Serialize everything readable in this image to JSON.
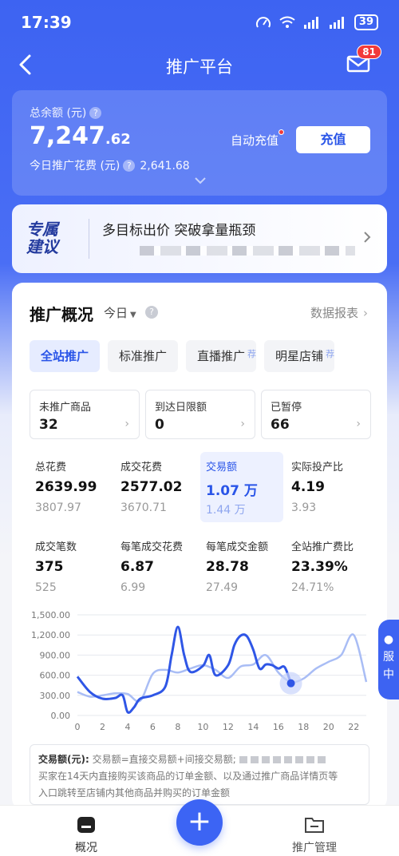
{
  "status_bar": {
    "time": "17:39",
    "battery": "39"
  },
  "nav": {
    "title": "推广平台",
    "mail_badge": "81"
  },
  "balance": {
    "label": "总余额 (元)",
    "amount_int": "7,247",
    "amount_dec": ".62",
    "today_label": "今日推广花费 (元)",
    "today_value": "2,641.68",
    "auto_recharge": "自动充值",
    "recharge_button": "充值"
  },
  "banner": {
    "logo_line1": "专属",
    "logo_line2": "建议",
    "text": "多目标出价 突破拿量瓶颈"
  },
  "overview": {
    "title": "推广概况",
    "date": "今日",
    "report_link": "数据报表",
    "tabs": [
      {
        "label": "全站推广",
        "rec": ""
      },
      {
        "label": "标准推广",
        "rec": ""
      },
      {
        "label": "直播推广",
        "rec": "荐"
      },
      {
        "label": "明星店铺",
        "rec": "荐"
      }
    ],
    "stat_boxes": [
      {
        "label": "未推广商品",
        "value": "32"
      },
      {
        "label": "到达日限额",
        "value": "0"
      },
      {
        "label": "已暂停",
        "value": "66"
      }
    ],
    "metrics": [
      {
        "label": "总花费",
        "value": "2639.99",
        "sub": "3807.97"
      },
      {
        "label": "成交花费",
        "value": "2577.02",
        "sub": "3670.71"
      },
      {
        "label": "交易额",
        "value": "1.07 万",
        "sub": "1.44 万"
      },
      {
        "label": "实际投产比",
        "value": "4.19",
        "sub": "3.93"
      },
      {
        "label": "成交笔数",
        "value": "375",
        "sub": "525"
      },
      {
        "label": "每笔成交花费",
        "value": "6.87",
        "sub": "6.99"
      },
      {
        "label": "每笔成交金额",
        "value": "28.78",
        "sub": "27.49"
      },
      {
        "label": "全站推广费比",
        "value": "23.39%",
        "sub": "24.71%"
      }
    ]
  },
  "chart_data": {
    "type": "line",
    "y_ticks": [
      "1,500.00",
      "1,200.00",
      "900.00",
      "600.00",
      "300.00",
      "0.00"
    ],
    "x_ticks": [
      "0",
      "2",
      "4",
      "6",
      "8",
      "10",
      "12",
      "14",
      "16",
      "18",
      "20",
      "22"
    ],
    "ylim": [
      0,
      1500
    ],
    "xlim": [
      0,
      23
    ],
    "series": [
      {
        "color": "#2f56e6",
        "x": [
          0,
          1,
          2,
          3,
          3.6,
          4,
          4.5,
          5,
          6,
          7,
          7.5,
          8,
          8.5,
          9,
          10,
          10.5,
          11,
          12,
          12.5,
          13,
          13.5,
          14,
          14.5,
          15,
          15.5,
          16,
          16.5,
          17
        ],
        "y": [
          580,
          350,
          250,
          260,
          300,
          50,
          120,
          250,
          300,
          430,
          900,
          1320,
          900,
          650,
          740,
          900,
          600,
          750,
          1050,
          1190,
          1180,
          980,
          700,
          760,
          750,
          700,
          720,
          480
        ]
      },
      {
        "color": "#a9bdf5",
        "x": [
          0,
          1,
          2,
          3,
          4,
          5,
          6,
          7,
          8,
          9,
          10,
          11,
          12,
          13,
          14,
          15,
          16,
          17,
          18,
          19,
          20,
          21,
          22,
          23
        ],
        "y": [
          350,
          280,
          300,
          330,
          320,
          220,
          620,
          680,
          640,
          700,
          750,
          680,
          560,
          730,
          760,
          900,
          640,
          500,
          550,
          700,
          800,
          900,
          1200,
          500
        ]
      }
    ],
    "highlight": {
      "x": 17,
      "y": 480
    }
  },
  "note": {
    "title": "交易额(元):",
    "line1": "交易额=直接交易额+间接交易额;",
    "line2": "买家在14天内直接购买该商品的订单金额、以及通过推广商品详情页等",
    "line3": "入口跳转至店铺内其他商品并购买的订单金额"
  },
  "float_tab": {
    "line1": "服",
    "line2": "中"
  },
  "bottom_nav": {
    "overview": "概况",
    "manage": "推广管理"
  }
}
